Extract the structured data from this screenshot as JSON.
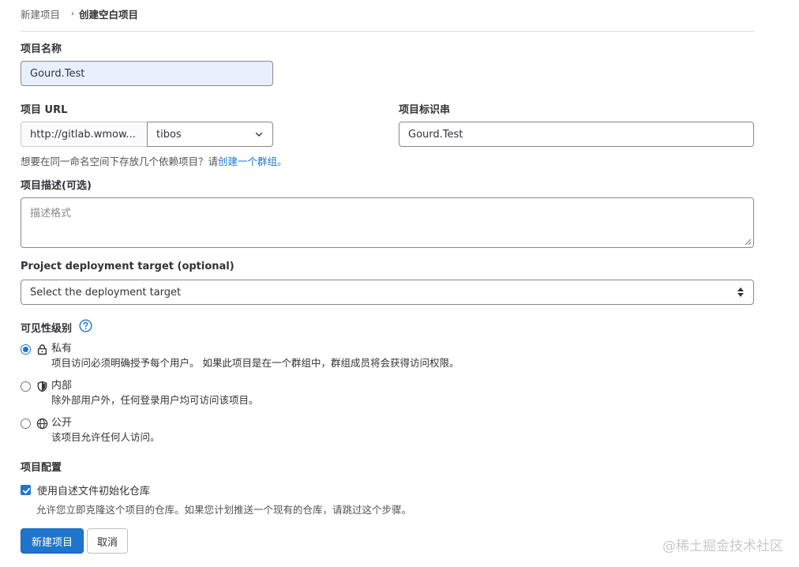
{
  "breadcrumb": {
    "parent": "新建项目",
    "separator": "›",
    "current": "创建空白项目"
  },
  "project_name": {
    "label": "项目名称",
    "value": "Gourd.Test"
  },
  "project_url": {
    "label": "项目 URL",
    "prefix": "http://gitlab.wmow...",
    "namespace": "tibos"
  },
  "project_slug": {
    "label": "项目标识串",
    "value": "Gourd.Test"
  },
  "group_help": {
    "text": "想要在同一命名空间下存放几个依赖项目？请",
    "link": "创建一个群组。"
  },
  "description": {
    "label": "项目描述(可选)",
    "placeholder": "描述格式"
  },
  "deployment": {
    "label": "Project deployment target (optional)",
    "selected": "Select the deployment target"
  },
  "visibility": {
    "label": "可见性级别",
    "options": [
      {
        "title": "私有",
        "desc": "项目访问必须明确授予每个用户。 如果此项目是在一个群组中，群组成员将会获得访问权限。",
        "icon": "lock-icon",
        "checked": true
      },
      {
        "title": "内部",
        "desc": "除外部用户外，任何登录用户均可访问该项目。",
        "icon": "shield-icon",
        "checked": false
      },
      {
        "title": "公开",
        "desc": "该项目允许任何人访问。",
        "icon": "globe-icon",
        "checked": false
      }
    ]
  },
  "config": {
    "label": "项目配置",
    "readme_label": "使用自述文件初始化仓库",
    "readme_desc": "允许您立即克隆这个项目的仓库。如果您计划推送一个现有的仓库，请跳过这个步骤。"
  },
  "buttons": {
    "create": "新建项目",
    "cancel": "取消"
  },
  "watermark": "@稀土掘金技术社区",
  "colors": {
    "accent": "#1f75cb",
    "autofill": "#e8f0fe",
    "border": "#89888d"
  }
}
